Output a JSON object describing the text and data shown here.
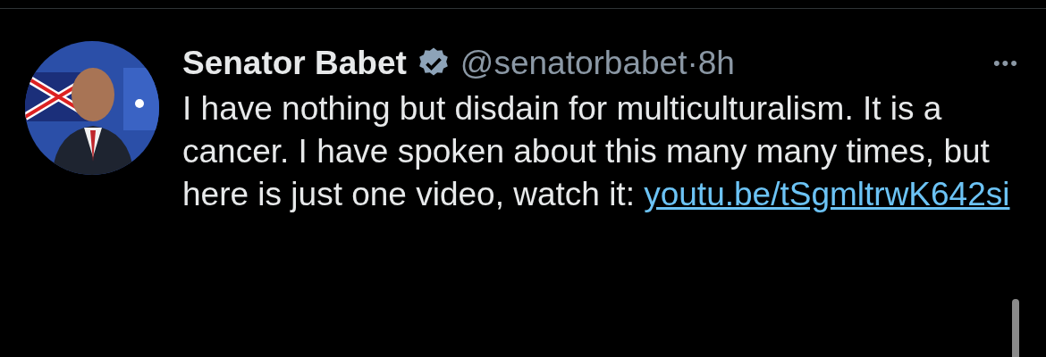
{
  "tweet": {
    "author": {
      "name": "Senator Babet",
      "verified": true,
      "handle": "@senatorbabet",
      "separator": "·",
      "time": "8h"
    },
    "more": "•••",
    "text": "I have nothing but disdain for multiculturalism. It is a cancer. I have spoken about this many many times, but here is just one video, watch it:",
    "link": "youtu.be/tSgmltrwK642si"
  }
}
